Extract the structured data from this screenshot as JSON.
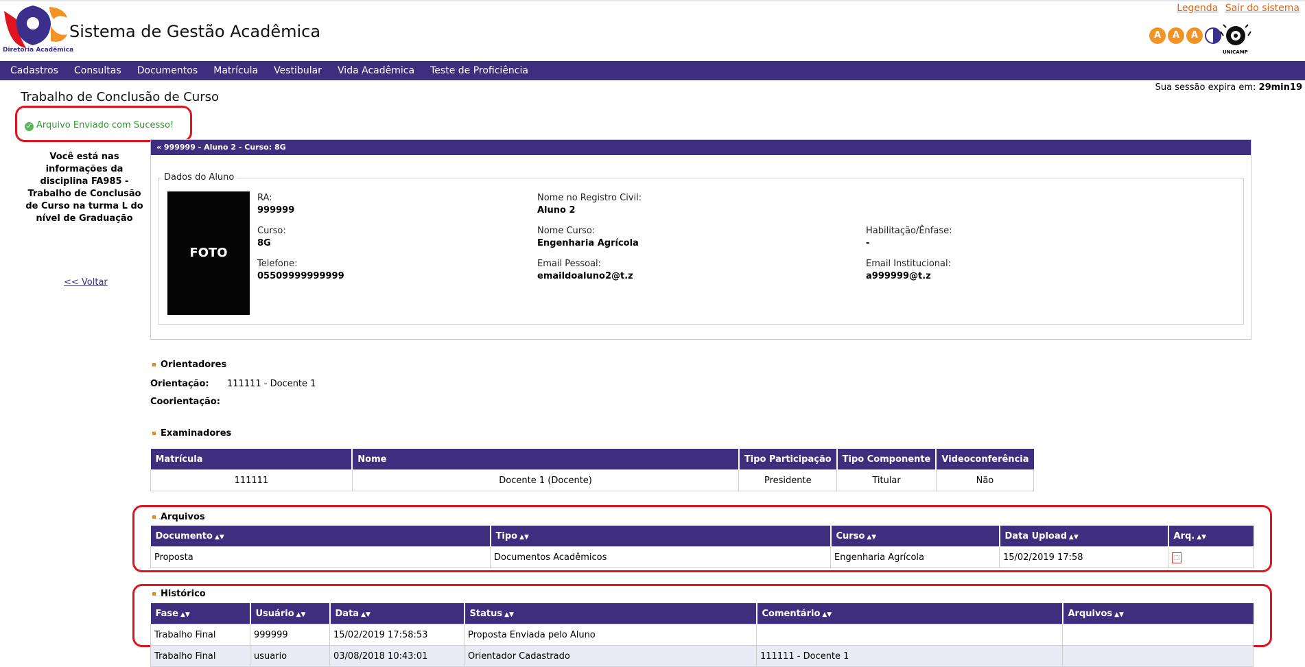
{
  "header": {
    "title": "Sistema de Gestão Acadêmica",
    "logo_caption": "Diretoria Acadêmica",
    "links": [
      "Legenda",
      "Sair do sistema"
    ],
    "badge_letter": "A",
    "unicamp_label": "UNICAMP"
  },
  "nav": [
    "Cadastros",
    "Consultas",
    "Documentos",
    "Matrícula",
    "Vestibular",
    "Vida Acadêmica",
    "Teste de Proficiência"
  ],
  "session": {
    "label": "Sua sessão expira em:",
    "time": "29min19"
  },
  "page_title": "Trabalho de Conclusão de Curso",
  "success_msg": "Arquivo Enviado com Sucesso!",
  "sidebar": {
    "info": "Você está nas informações da disciplina FA985 - Trabalho de Conclusão de Curso na turma L do nível de Graduação",
    "back": "<< Voltar"
  },
  "student": {
    "header": "« 999999 - Aluno 2 - Curso: 8G",
    "legend": "Dados do Aluno",
    "photo": "FOTO",
    "ra_label": "RA:",
    "ra": "999999",
    "nome_label": "Nome no Registro Civil:",
    "nome": "Aluno 2",
    "curso_label": "Curso:",
    "curso": "8G",
    "nome_curso_label": "Nome Curso:",
    "nome_curso": "Engenharia Agrícola",
    "hab_label": "Habilitação/Ênfase:",
    "hab": "-",
    "tel_label": "Telefone:",
    "tel": "05509999999999",
    "email_label": "Email Pessoal:",
    "email": "emaildoaluno2@t.z",
    "email_inst_label": "Email Institucional:",
    "email_inst": "a999999@t.z"
  },
  "orientadores": {
    "title": "Orientadores",
    "orientacao_label": "Orientação:",
    "orientacao": "111111 - Docente 1",
    "coorientacao_label": "Coorientação:"
  },
  "examinadores": {
    "title": "Examinadores",
    "headers": [
      "Matrícula",
      "Nome",
      "Tipo Participação",
      "Tipo Componente",
      "Videoconferência"
    ],
    "rows": [
      [
        "111111",
        "Docente 1 (Docente)",
        "Presidente",
        "Titular",
        "Não"
      ]
    ]
  },
  "arquivos": {
    "title": "Arquivos",
    "headers": [
      "Documento",
      "Tipo",
      "Curso",
      "Data Upload",
      "Arq."
    ],
    "rows": [
      [
        "Proposta",
        "Documentos Acadêmicos",
        "Engenharia Agrícola",
        "15/02/2019 17:58"
      ]
    ]
  },
  "historico": {
    "title": "Histórico",
    "headers": [
      "Fase",
      "Usuário",
      "Data",
      "Status",
      "Comentário",
      "Arquivos"
    ],
    "rows": [
      [
        "Trabalho Final",
        "999999",
        "15/02/2019 17:58:53",
        "Proposta Enviada pelo Aluno",
        "",
        ""
      ],
      [
        "Trabalho Final",
        "usuario",
        "03/08/2018 10:43:01",
        "Orientador Cadastrado",
        "111111 - Docente 1",
        ""
      ]
    ]
  },
  "colors": {
    "primary": "#3e2e7e",
    "accent": "#e58a1c",
    "highlight": "#e0141e",
    "success": "#2d9a2d"
  },
  "icons": {
    "success": "check-circle-icon",
    "sort": "sort-arrows-icon",
    "file": "pdf-file-icon",
    "sections": "orange-square-bullet-icon"
  }
}
